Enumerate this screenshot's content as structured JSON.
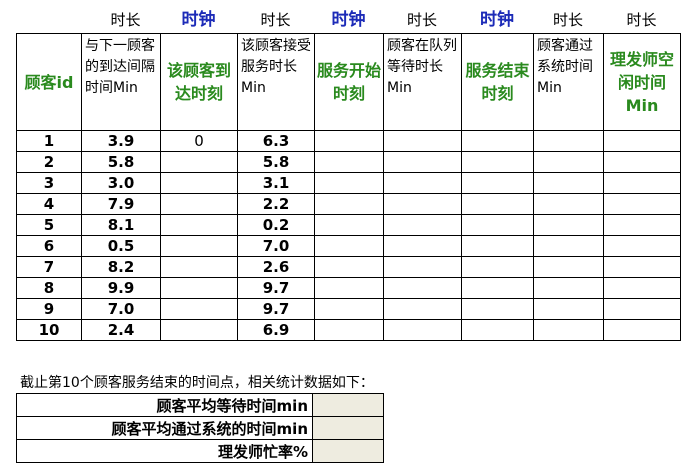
{
  "top_labels": [
    "时长",
    "时钟",
    "时长",
    "时钟",
    "时长",
    "时钟",
    "时长",
    "时长"
  ],
  "headers": [
    "顾客id",
    "与下一顾客的到达间隔时间Min",
    "该顾客到达时刻",
    "该顾客接受服务时长Min",
    "服务开始时刻",
    "顾客在队列等待时长Min",
    "服务结束时刻",
    "顾客通过系统时间Min",
    "理发师空闲时间Min"
  ],
  "rows": [
    {
      "id": "1",
      "interval": "3.9",
      "arrival": "0",
      "service": "6.3"
    },
    {
      "id": "2",
      "interval": "5.8",
      "arrival": "",
      "service": "5.8"
    },
    {
      "id": "3",
      "interval": "3.0",
      "arrival": "",
      "service": "3.1"
    },
    {
      "id": "4",
      "interval": "7.9",
      "arrival": "",
      "service": "2.2"
    },
    {
      "id": "5",
      "interval": "8.1",
      "arrival": "",
      "service": "0.2"
    },
    {
      "id": "6",
      "interval": "0.5",
      "arrival": "",
      "service": "7.0"
    },
    {
      "id": "7",
      "interval": "8.2",
      "arrival": "",
      "service": "2.6"
    },
    {
      "id": "8",
      "interval": "9.9",
      "arrival": "",
      "service": "9.7"
    },
    {
      "id": "9",
      "interval": "7.0",
      "arrival": "",
      "service": "9.7"
    },
    {
      "id": "10",
      "interval": "2.4",
      "arrival": "",
      "service": "6.9"
    }
  ],
  "note": "截止第10个顾客服务结束的时间点，相关统计数据如下：",
  "stats": [
    {
      "label": "顾客平均等待时间min",
      "value": ""
    },
    {
      "label": "顾客平均通过系统的时间min",
      "value": ""
    },
    {
      "label": "理发师忙率%",
      "value": ""
    }
  ],
  "colors": {
    "clock_label": "#1c2bb8",
    "green_header": "#2a8a1e",
    "stat_cell": "#eeece0"
  }
}
